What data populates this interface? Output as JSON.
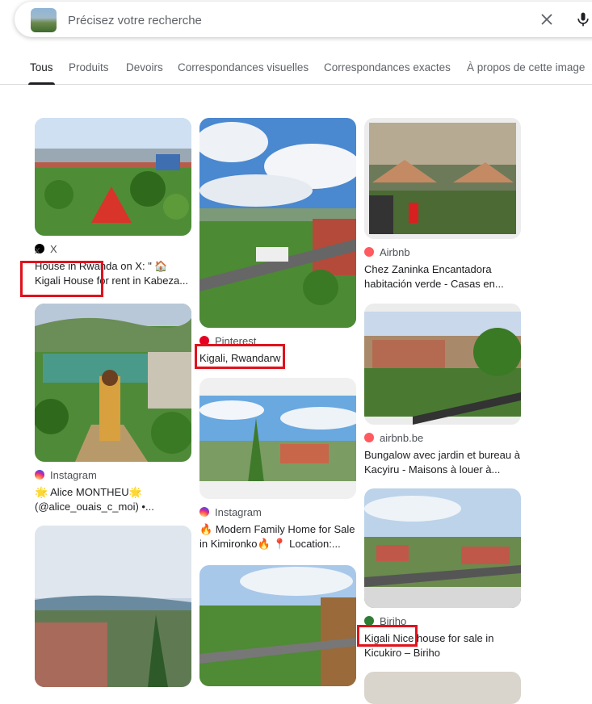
{
  "search": {
    "placeholder": "Précisez votre recherche",
    "value": ""
  },
  "tabs": [
    {
      "label": "Tous",
      "active": true
    },
    {
      "label": "Produits",
      "active": false
    },
    {
      "label": "Devoirs",
      "active": false
    },
    {
      "label": "Correspondances visuelles",
      "active": false
    },
    {
      "label": "Correspondances exactes",
      "active": false
    },
    {
      "label": "À propos de cette image",
      "active": false
    }
  ],
  "results": [
    {
      "source": "X",
      "icon": "x-logo-icon",
      "title": "House in Rwanda on X: \" 🏠 Kigali House for rent in Kabeza..."
    },
    {
      "source": "Pinterest",
      "icon": "pinterest-logo-icon",
      "title": "Kigali, Rwandarw"
    },
    {
      "source": "Airbnb",
      "icon": "airbnb-logo-icon",
      "title": "Chez Zaninka Encantadora habitación verde - Casas en..."
    },
    {
      "source": "Instagram",
      "icon": "instagram-logo-icon",
      "title": "🌟 Alice MONTHEU🌟 (@alice_ouais_c_moi) •..."
    },
    {
      "source": "airbnb.be",
      "icon": "airbnb-logo-icon",
      "title": "Bungalow avec jardin et bureau à Kacyiru - Maisons à louer à..."
    },
    {
      "source": "Instagram",
      "icon": "instagram-logo-icon",
      "title": "🔥 Modern Family Home for Sale in Kimironko🔥 📍 Location:..."
    },
    {
      "source": "Biriho",
      "icon": "biriho-logo-icon",
      "title": "Kigali Nice house for sale in Kicukiro – Biriho"
    }
  ],
  "colors": {
    "highlight_box": "#e0121c",
    "tab_active": "#202124",
    "text_secondary": "#5f6368"
  }
}
